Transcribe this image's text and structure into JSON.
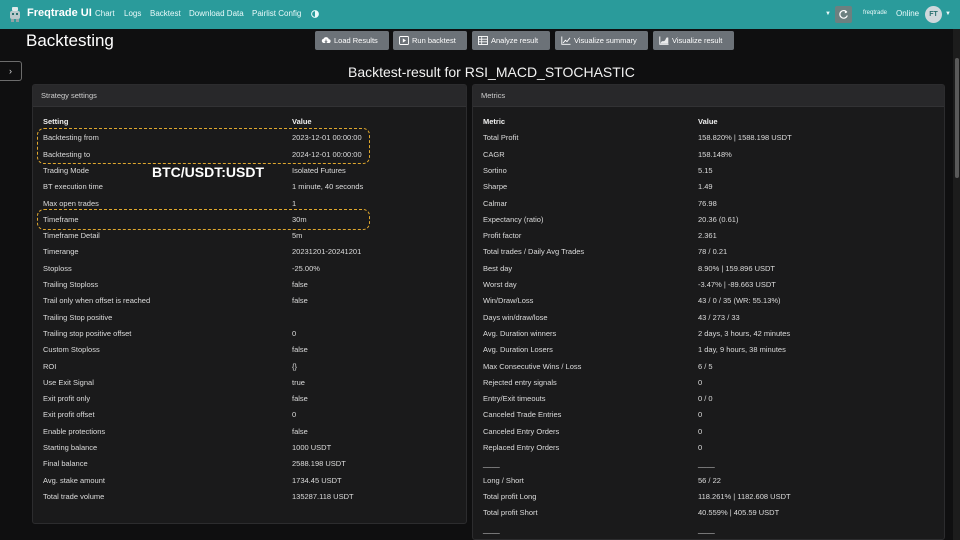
{
  "navbar": {
    "brand": "Freqtrade UI",
    "links": [
      "Chart",
      "Logs",
      "Backtest",
      "Download Data",
      "Pairlist Config"
    ],
    "bot_name": "freqtrade",
    "status": "Online",
    "avatar": "FT",
    "accent_color": "#2a9b9b"
  },
  "page": {
    "title": "Backtesting",
    "result_title": "Backtest-result for RSI_MACD_STOCHASTIC",
    "overlay_label": "BTC/USDT:USDT"
  },
  "toolbar": {
    "load": "Load Results",
    "run": "Run backtest",
    "analyze": "Analyze result",
    "vis_summary": "Visualize summary",
    "vis_result": "Visualize result"
  },
  "strategy": {
    "header": "Strategy settings",
    "col_setting": "Setting",
    "col_value": "Value",
    "rows": [
      {
        "k": "Backtesting from",
        "v": "2023-12-01 00:00:00"
      },
      {
        "k": "Backtesting to",
        "v": "2024-12-01 00:00:00"
      },
      {
        "k": "Trading Mode",
        "v": "Isolated Futures"
      },
      {
        "k": "BT execution time",
        "v": "1 minute, 40 seconds"
      },
      {
        "k": "Max open trades",
        "v": "1"
      },
      {
        "k": "Timeframe",
        "v": "30m"
      },
      {
        "k": "Timeframe Detail",
        "v": "5m"
      },
      {
        "k": "Timerange",
        "v": "20231201-20241201"
      },
      {
        "k": "Stoploss",
        "v": "-25.00%"
      },
      {
        "k": "Trailing Stoploss",
        "v": "false"
      },
      {
        "k": "Trail only when offset is reached",
        "v": "false"
      },
      {
        "k": "Trailing Stop positive",
        "v": ""
      },
      {
        "k": "Trailing stop positive offset",
        "v": "0"
      },
      {
        "k": "Custom Stoploss",
        "v": "false"
      },
      {
        "k": "ROI",
        "v": "{}"
      },
      {
        "k": "Use Exit Signal",
        "v": "true"
      },
      {
        "k": "Exit profit only",
        "v": "false"
      },
      {
        "k": "Exit profit offset",
        "v": "0"
      },
      {
        "k": "Enable protections",
        "v": "false"
      },
      {
        "k": "Starting balance",
        "v": "1000 USDT"
      },
      {
        "k": "Final balance",
        "v": "2588.198 USDT"
      },
      {
        "k": "Avg. stake amount",
        "v": "1734.45 USDT"
      },
      {
        "k": "Total trade volume",
        "v": "135287.118 USDT"
      }
    ]
  },
  "metrics": {
    "header": "Metrics",
    "col_metric": "Metric",
    "col_value": "Value",
    "rows": [
      {
        "k": "Total Profit",
        "v": "158.820% | 1588.198 USDT"
      },
      {
        "k": "CAGR",
        "v": "158.148%"
      },
      {
        "k": "Sortino",
        "v": "5.15"
      },
      {
        "k": "Sharpe",
        "v": "1.49"
      },
      {
        "k": "Calmar",
        "v": "76.98"
      },
      {
        "k": "Expectancy (ratio)",
        "v": "20.36 (0.61)"
      },
      {
        "k": "Profit factor",
        "v": "2.361"
      },
      {
        "k": "Total trades / Daily Avg Trades",
        "v": "78 / 0.21"
      },
      {
        "k": "Best day",
        "v": "8.90% | 159.896 USDT"
      },
      {
        "k": "Worst day",
        "v": "-3.47% | -89.663 USDT"
      },
      {
        "k": "Win/Draw/Loss",
        "v": "43 / 0 / 35 (WR: 55.13%)"
      },
      {
        "k": "Days win/draw/lose",
        "v": "43 / 273 / 33"
      },
      {
        "k": "Avg. Duration winners",
        "v": "2 days, 3 hours, 42 minutes"
      },
      {
        "k": "Avg. Duration Losers",
        "v": "1 day, 9 hours, 38 minutes"
      },
      {
        "k": "Max Consecutive Wins / Loss",
        "v": "6 / 5"
      },
      {
        "k": "Rejected entry signals",
        "v": "0"
      },
      {
        "k": "Entry/Exit timeouts",
        "v": "0 / 0"
      },
      {
        "k": "Canceled Trade Entries",
        "v": "0"
      },
      {
        "k": "Canceled Entry Orders",
        "v": "0"
      },
      {
        "k": "Replaced Entry Orders",
        "v": "0"
      },
      {
        "k": "____",
        "v": "____"
      },
      {
        "k": "Long / Short",
        "v": "56 / 22"
      },
      {
        "k": "Total profit Long",
        "v": "118.261% | 1182.608 USDT"
      },
      {
        "k": "Total profit Short",
        "v": "40.559% | 405.59 USDT"
      },
      {
        "k": "____",
        "v": "____"
      }
    ]
  }
}
